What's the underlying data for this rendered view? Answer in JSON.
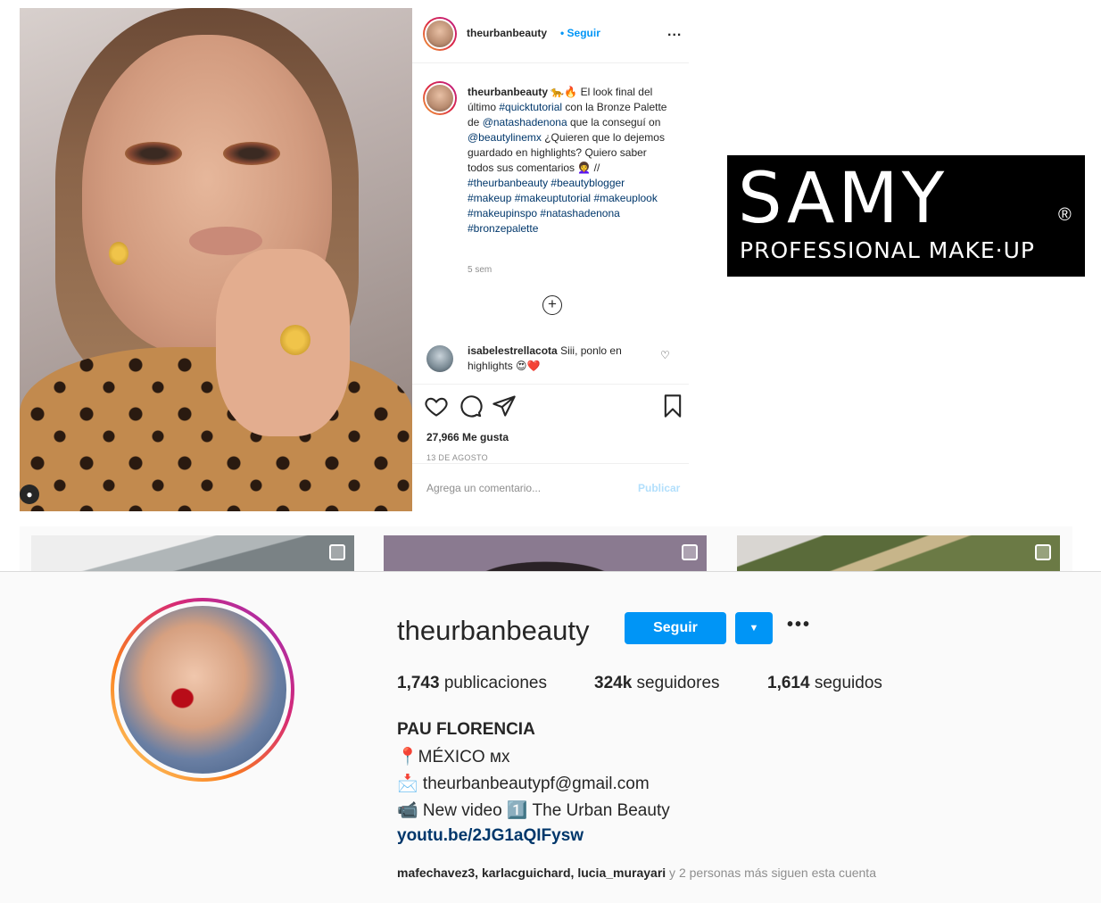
{
  "post": {
    "username": "theurbanbeauty",
    "follow_label": "Seguir",
    "more_label": "...",
    "caption_user": "theurbanbeauty",
    "caption_emoji": "🐆🔥",
    "caption_parts": [
      {
        "t": " El look final del último ",
        "link": false
      },
      {
        "t": "#quicktutorial",
        "link": true
      },
      {
        "t": " con la Bronze Palette de ",
        "link": false
      },
      {
        "t": "@natashadenona",
        "link": true
      },
      {
        "t": " que la conseguí on ",
        "link": false
      },
      {
        "t": "@beautylinemx",
        "link": true
      },
      {
        "t": " ¿Quieren que lo dejemos guardado en highlights? Quiero saber todos sus comentarios 👩‍🦱 // ",
        "link": false
      },
      {
        "t": "#theurbanbeauty",
        "link": true
      },
      {
        "t": " ",
        "link": false
      },
      {
        "t": "#beautyblogger",
        "link": true
      },
      {
        "t": " ",
        "link": false
      },
      {
        "t": "#makeup",
        "link": true
      },
      {
        "t": " ",
        "link": false
      },
      {
        "t": "#makeuptutorial",
        "link": true
      },
      {
        "t": " ",
        "link": false
      },
      {
        "t": "#makeuplook",
        "link": true
      },
      {
        "t": " ",
        "link": false
      },
      {
        "t": "#makeupinspo",
        "link": true
      },
      {
        "t": " ",
        "link": false
      },
      {
        "t": "#natashadenona",
        "link": true
      },
      {
        "t": " ",
        "link": false
      },
      {
        "t": "#bronzepalette",
        "link": true
      }
    ],
    "caption_time": "5 sem",
    "comment_user": "isabelestrellacota",
    "comment_text": " Siii, ponlo en highlights 😍❤️",
    "likes": "27,966 Me gusta",
    "date": "13 DE AGOSTO",
    "comment_placeholder": "Agrega un comentario...",
    "publish_label": "Publicar"
  },
  "logo": {
    "brand": "SAMY",
    "registered": "®",
    "tagline": "PROFESSIONAL MAKE·UP"
  },
  "profile": {
    "username": "theurbanbeauty",
    "follow_label": "Seguir",
    "dropdown_icon": "caret-down-icon",
    "more_label": "•••",
    "stats": [
      {
        "count": "1,743",
        "label": " publicaciones"
      },
      {
        "count": "324k",
        "label": " seguidores"
      },
      {
        "count": "1,614",
        "label": " seguidos"
      }
    ],
    "full_name": "PAU FLORENCIA",
    "bio_lines": [
      "📍MÉXICO ᴍx",
      "📩 theurbanbeautypf@gmail.com",
      "📹 New video 1️⃣ The Urban Beauty"
    ],
    "link": "youtu.be/2JG1aQIFysw",
    "followed_by_users": "mafechavez3, karlacguichard, lucia_murayari",
    "followed_by_rest": " y 2 personas más siguen esta cuenta"
  },
  "colors": {
    "accent_blue": "#0095f6",
    "link_blue": "#00376b",
    "muted": "#8e8e8e"
  }
}
